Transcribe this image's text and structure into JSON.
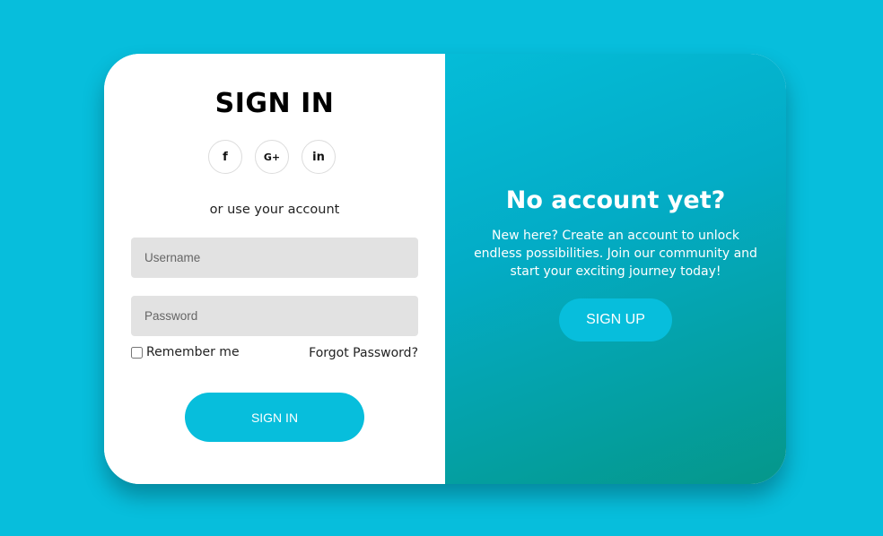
{
  "signin": {
    "title": "SIGN IN",
    "socials": [
      {
        "icon": "facebook-icon",
        "glyph": "f"
      },
      {
        "icon": "google-plus-icon",
        "glyph": "G+"
      },
      {
        "icon": "linkedin-icon",
        "glyph": "in"
      }
    ],
    "subtitle": "or use your account",
    "username_placeholder": "Username",
    "password_placeholder": "Password",
    "remember_label": "Remember me",
    "forgot_label": "Forgot Password?",
    "button_label": "SIGN IN"
  },
  "signup": {
    "title": "No account yet?",
    "text": "New here? Create an account to unlock endless possibilities. Join our community and start your exciting journey today!",
    "button_label": "SIGN UP"
  },
  "colors": {
    "background": "#07BEDC",
    "accent": "#07BEDC",
    "gradient_end": "#05978A"
  }
}
